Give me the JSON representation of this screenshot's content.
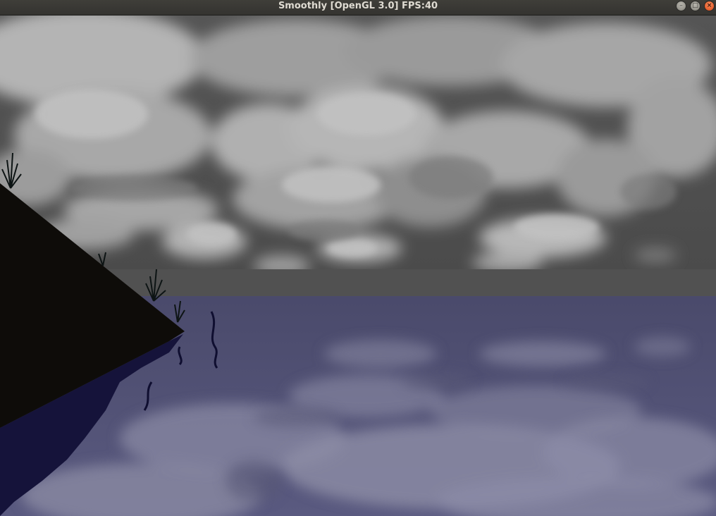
{
  "window": {
    "title": "Smoothly [OpenGL 3.0] FPS:40",
    "buttons": {
      "minimize_glyph": "–",
      "maximize_glyph": "□",
      "close_glyph": "×"
    }
  },
  "scene": {
    "sky_color": "#4f4f4f",
    "cloud_color": "#a9a9a9",
    "water_color": "#4c4b6f",
    "water_reflection_color": "#8a8aa3",
    "terrain_color": "#0e0c09",
    "shore_shadow_color": "#14123a",
    "plant_color": "#0d1414"
  }
}
